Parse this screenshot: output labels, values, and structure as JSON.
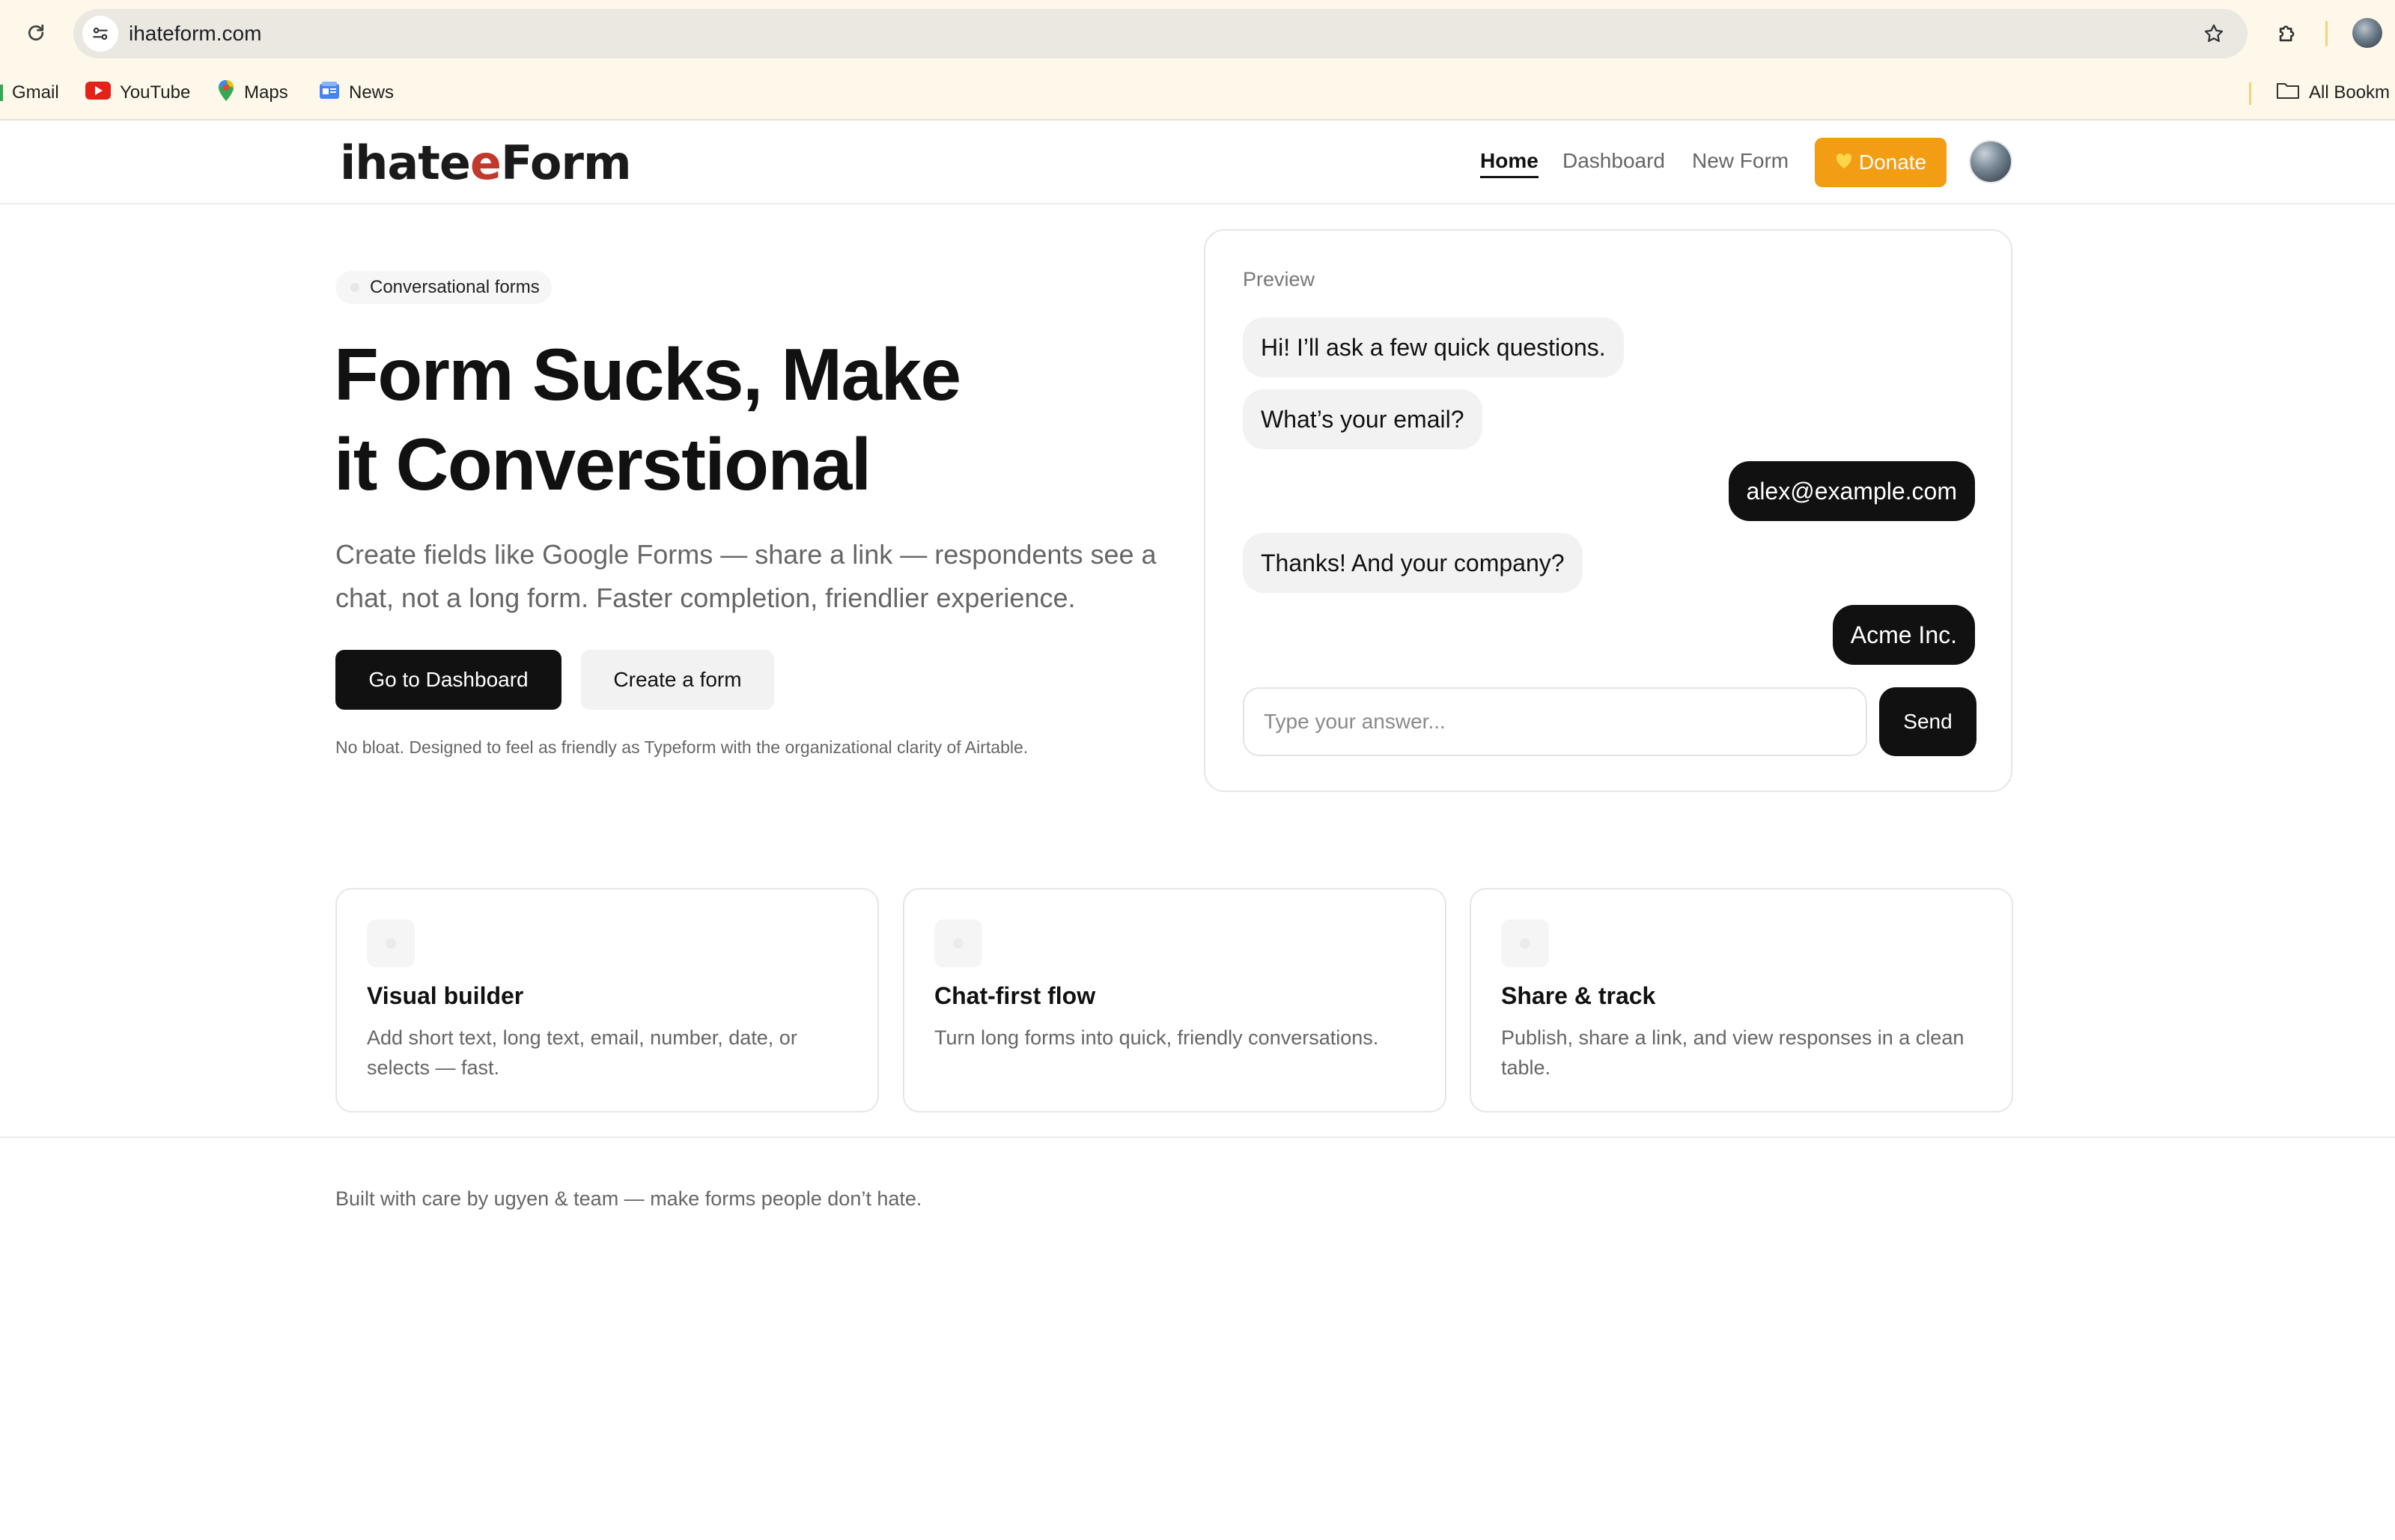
{
  "browser": {
    "url": "ihateform.com",
    "bookmarks": [
      {
        "label": "Gmail",
        "icon": "gmail-icon"
      },
      {
        "label": "YouTube",
        "icon": "youtube-icon"
      },
      {
        "label": "Maps",
        "icon": "maps-icon"
      },
      {
        "label": "News",
        "icon": "news-icon"
      }
    ],
    "all_bookmarks_label": "All Bookm"
  },
  "header": {
    "logo_prefix": "ihate",
    "logo_accent": "e",
    "logo_suffix": "Form",
    "nav": [
      {
        "label": "Home",
        "active": true
      },
      {
        "label": "Dashboard",
        "active": false
      },
      {
        "label": "New Form",
        "active": false
      }
    ],
    "donate_label": "Donate",
    "donate_icon": "heart-icon"
  },
  "hero": {
    "pill": "Conversational forms",
    "title_line1": "Form Sucks, Make",
    "title_line2": "it Converstional",
    "subtitle": "Create fields like Google Forms — share a link — respondents see a chat, not a long form. Faster completion, friendlier experience.",
    "primary_button": "Go to Dashboard",
    "secondary_button": "Create a form",
    "note": "No bloat. Designed to feel as friendly as Typeform with the organizational clarity of Airtable."
  },
  "preview": {
    "label": "Preview",
    "messages": [
      {
        "from": "bot",
        "text": "Hi! I’ll ask a few quick questions."
      },
      {
        "from": "bot",
        "text": "What’s your email?"
      },
      {
        "from": "user",
        "text": "alex@example.com"
      },
      {
        "from": "bot",
        "text": "Thanks! And your company?"
      },
      {
        "from": "user",
        "text": "Acme Inc."
      }
    ],
    "input_placeholder": "Type your answer...",
    "send_label": "Send"
  },
  "features": [
    {
      "title": "Visual builder",
      "description": "Add short text, long text, email, number, date, or selects — fast."
    },
    {
      "title": "Chat-first flow",
      "description": "Turn long forms into quick, friendly conversations."
    },
    {
      "title": "Share & track",
      "description": "Publish, share a link, and view responses in a clean table."
    }
  ],
  "footer": {
    "text": "Built with care by ugyen & team — make forms people don’t hate."
  },
  "colors": {
    "accent_orange": "#f29d13",
    "logo_accent": "#c0392b",
    "dark": "#111111",
    "chrome_bg": "#fdf8ea"
  }
}
